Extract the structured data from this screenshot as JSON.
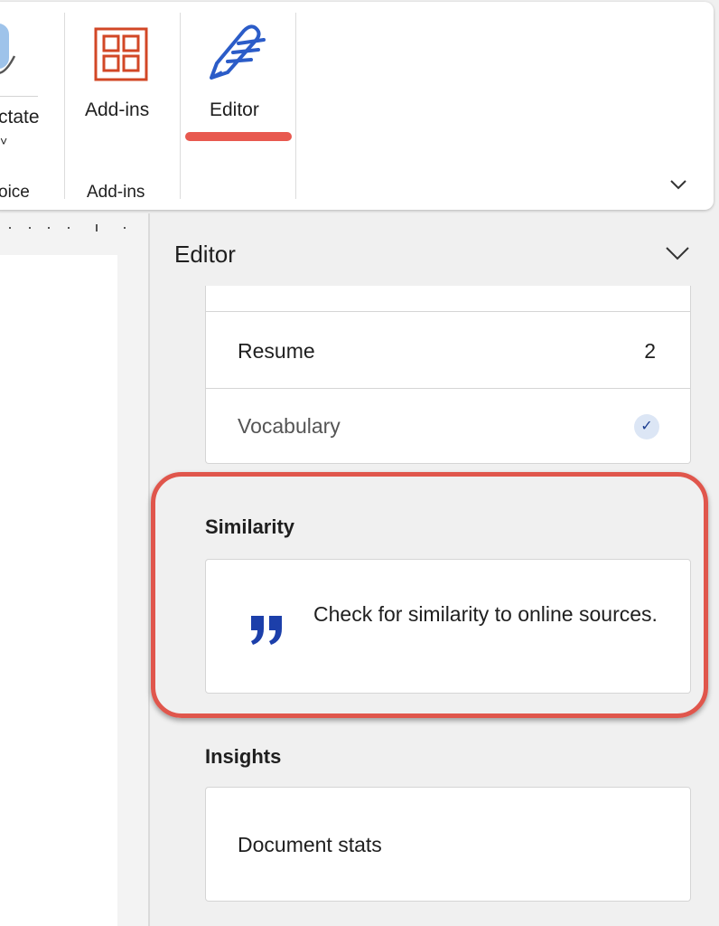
{
  "ribbon": {
    "dictate_label": "ctate",
    "voice_group_label": "oice",
    "addins_label": "Add-ins",
    "addins_group_label": "Add-ins",
    "editor_label": "Editor",
    "dictate_chevron": "˅"
  },
  "editor_pane": {
    "title": "Editor",
    "rows": [
      {
        "label": "Resume",
        "value": "2"
      },
      {
        "label": "Vocabulary",
        "value": "✓"
      }
    ],
    "similarity": {
      "heading": "Similarity",
      "text": "Check for similarity to online sources."
    },
    "insights": {
      "heading": "Insights",
      "item": "Document stats"
    }
  },
  "colors": {
    "highlight": "#e0564c",
    "editor_blue": "#2b5cc8",
    "addins_orange": "#d24726"
  }
}
